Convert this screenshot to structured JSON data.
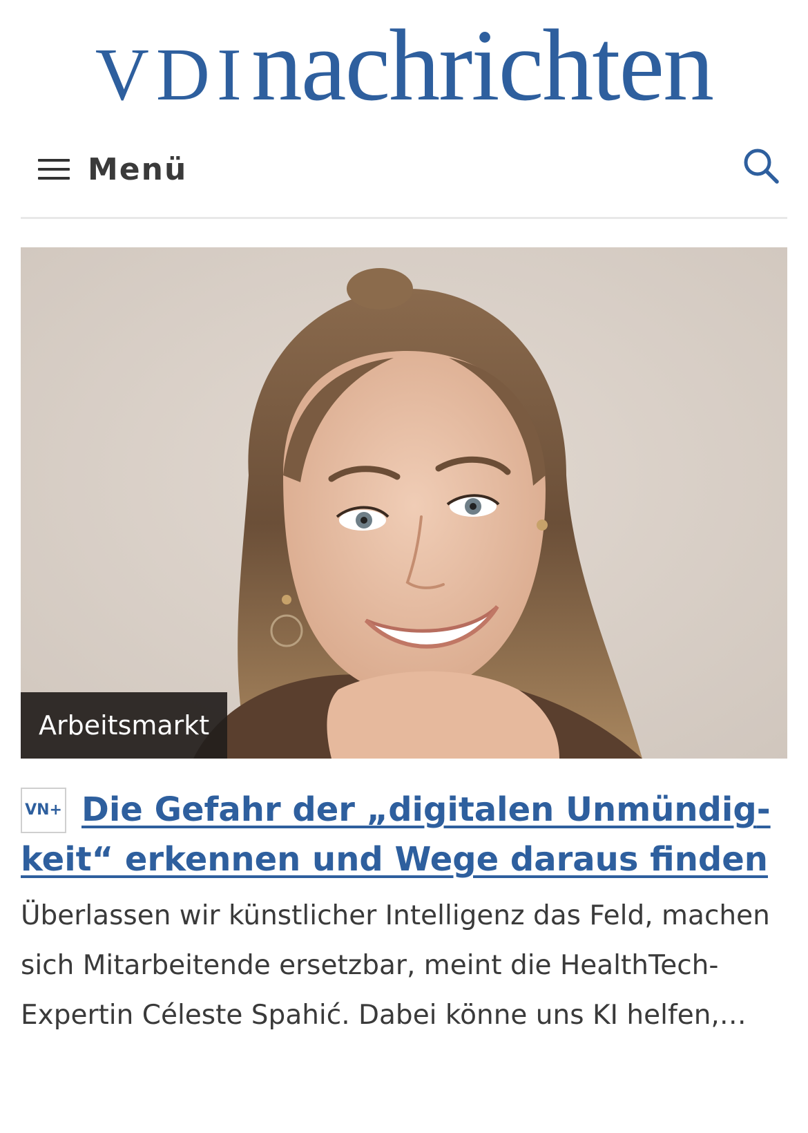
{
  "header": {
    "logo_vdi": "VDI",
    "logo_nachrichten": "nachrichten",
    "brand_color": "#2e5f9e"
  },
  "nav": {
    "menu_label": "Menü",
    "menu_icon": "hamburger-icon",
    "search_icon": "search-icon"
  },
  "article": {
    "category": "Arbeitsmarkt",
    "plus_badge": "VN+",
    "headline": "Die Gefahr der „digitalen Unmündig­keit“ erkennen und Wege daraus finden",
    "teaser": "Überlassen wir künstlicher Intelligenz das Feld, machen sich Mitarbeitende ersetzbar, meint die HealthTech-Expertin Céleste Spahić. Dabei könne uns KI helfen,…"
  }
}
